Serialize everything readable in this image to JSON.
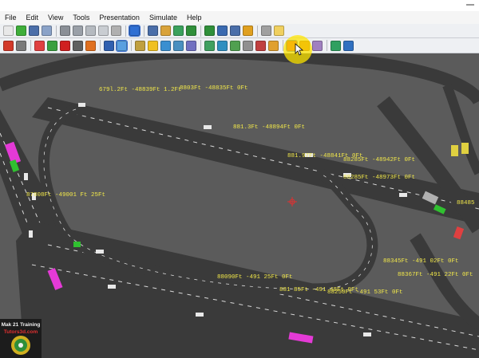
{
  "window": {
    "title": ""
  },
  "menubar": {
    "items": [
      "File",
      "Edit",
      "View",
      "Tools",
      "Presentation",
      "Simulate",
      "Help"
    ]
  },
  "toolbar1": {
    "buttons": [
      {
        "icon": "new-file-icon",
        "color": "#e8e8e8"
      },
      {
        "icon": "open-folder-icon",
        "color": "#3fae3a"
      },
      {
        "icon": "save-icon",
        "color": "#4a6ea9"
      },
      {
        "icon": "save-as-icon",
        "color": "#8aa2c8"
      },
      {
        "icon": "shield-icon",
        "color": "#8a8f96"
      },
      {
        "icon": "shield-icon",
        "color": "#9aa0a8"
      },
      {
        "icon": "shield-icon",
        "color": "#b5bac0"
      },
      {
        "icon": "shield-icon",
        "color": "#c9cdd2"
      },
      {
        "icon": "circle-icon",
        "color": "#b0b0b0"
      },
      {
        "icon": "shield-blue-icon",
        "color": "#2f6fd3"
      },
      {
        "icon": "grid-icon",
        "color": "#4a6ea9"
      },
      {
        "icon": "pencil-icon",
        "color": "#d9a33a"
      },
      {
        "icon": "palette-icon",
        "color": "#3aa15c"
      },
      {
        "icon": "arrow-left-icon",
        "color": "#2f8f3a"
      },
      {
        "icon": "arrow-right-icon",
        "color": "#2f8f3a"
      },
      {
        "icon": "route-icon",
        "color": "#3a6ab0"
      },
      {
        "icon": "person-icon",
        "color": "#4a6ea9"
      },
      {
        "icon": "tag-icon",
        "color": "#e0a020"
      },
      {
        "icon": "tools-icon",
        "color": "#a0a0a0"
      },
      {
        "icon": "note-icon",
        "color": "#f0d060"
      }
    ]
  },
  "toolbar2": {
    "buttons": [
      {
        "icon": "road-icon",
        "color": "#d23a2a"
      },
      {
        "icon": "wrench-icon",
        "color": "#7a7a7a"
      },
      {
        "icon": "pin-icon",
        "color": "#e04040"
      },
      {
        "icon": "road-green-icon",
        "color": "#3aa040"
      },
      {
        "icon": "stop-sign-icon",
        "color": "#d02020"
      },
      {
        "icon": "camera-icon",
        "color": "#606060"
      },
      {
        "icon": "cone-icon",
        "color": "#e07020"
      },
      {
        "icon": "car-icon",
        "color": "#3060b0"
      },
      {
        "icon": "view-icon",
        "color": "#5aa0e0"
      },
      {
        "icon": "ruler-icon",
        "color": "#c0a040"
      },
      {
        "icon": "bulb-icon",
        "color": "#f0c020"
      },
      {
        "icon": "globe-icon",
        "color": "#3a8fd0"
      },
      {
        "icon": "zoom-icon",
        "color": "#4a90c0"
      },
      {
        "icon": "list-icon",
        "color": "#7070c0"
      },
      {
        "icon": "color-icon",
        "color": "#40a060"
      },
      {
        "icon": "map-icon",
        "color": "#2f8fc0"
      },
      {
        "icon": "photo-icon",
        "color": "#50a050"
      },
      {
        "icon": "measure-icon",
        "color": "#909090"
      },
      {
        "icon": "traffic-icon",
        "color": "#c04040"
      },
      {
        "icon": "light-icon",
        "color": "#e0a030"
      },
      {
        "icon": "record-icon",
        "color": "#e03020"
      },
      {
        "icon": "play-icon",
        "color": "#d06020"
      },
      {
        "icon": "movie-icon",
        "color": "#a080c0"
      },
      {
        "icon": "layers-icon",
        "color": "#30a060"
      },
      {
        "icon": "help-icon",
        "color": "#3070c0"
      }
    ]
  },
  "scene": {
    "labels": [
      "679l.2Ft -48839Ft 1.2Ft",
      "8803Ft -48835Ft 0Ft",
      "881.3Ft -48894Ft 0Ft",
      "881.97Ft -48841Ft 0Ft",
      "88285Ft -48942Ft 0Ft",
      "88285Ft -48973Ft 0Ft",
      "87808Ft -49001 Ft 25Ft",
      "88345Ft -491 02Ft 0Ft",
      "88367Ft -491 22Ft 0Ft",
      "88090Ft -491 25Ft 0Ft",
      "881 85Ft -491 48Ft 0Ft",
      "88250Ft -491 53Ft 0Ft",
      "88485"
    ],
    "colors": {
      "ground": "#5b5b5b",
      "road": "#3a3a3a",
      "lane": "#d9d9d9",
      "label": "#f2e84a"
    }
  },
  "brand": {
    "line1": "Mak 21 Training",
    "line2": "Tutors3d.com"
  }
}
